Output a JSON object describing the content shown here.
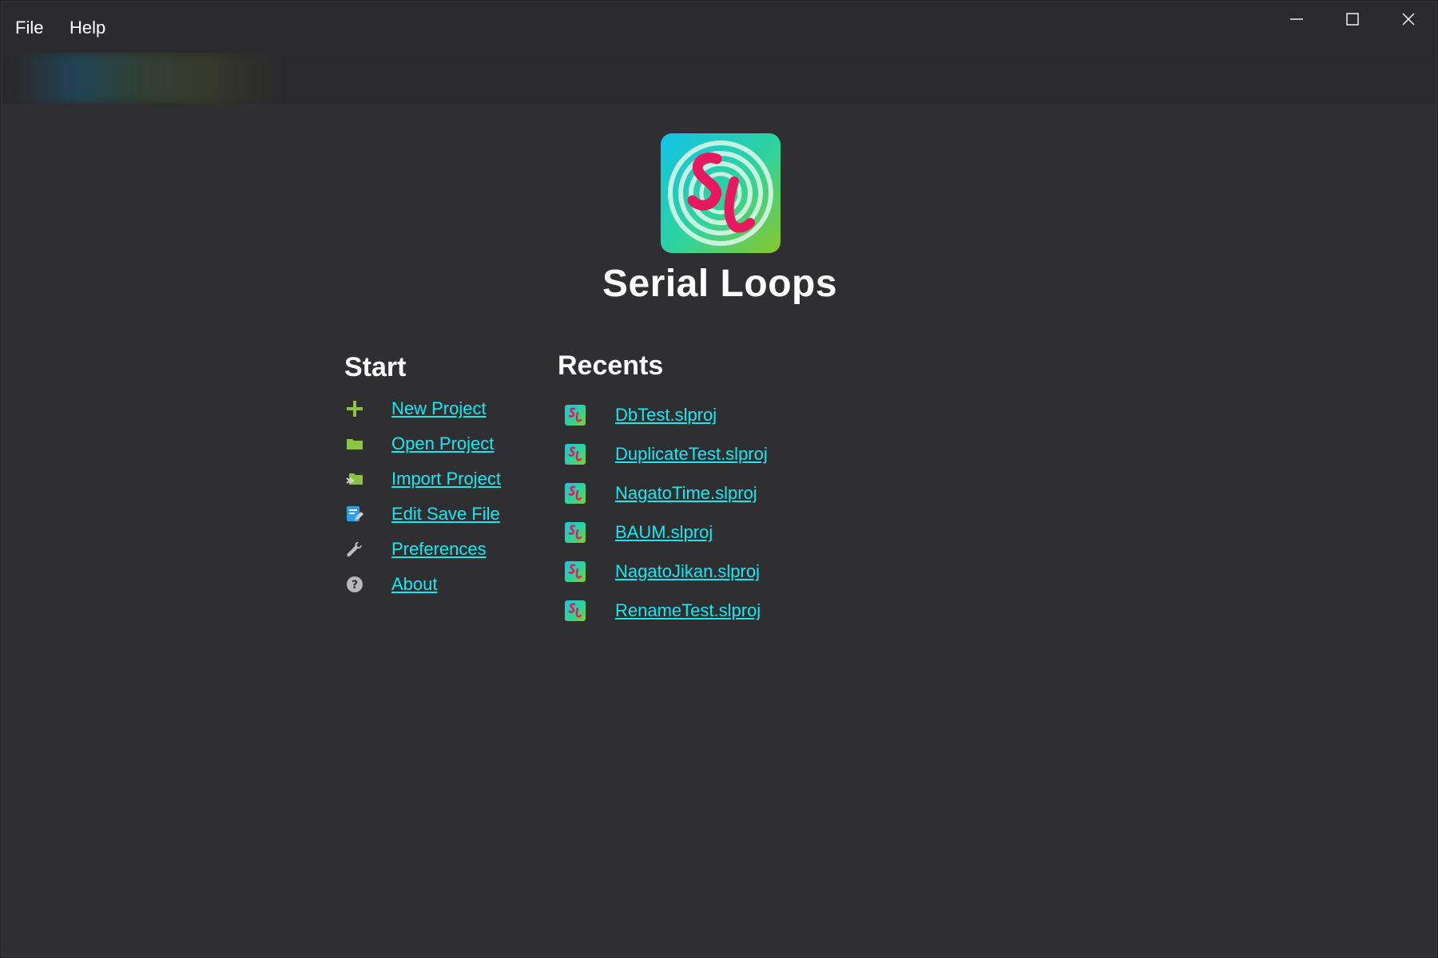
{
  "menu": {
    "file": "File",
    "help": "Help"
  },
  "app": {
    "title": "Serial Loops"
  },
  "start": {
    "heading": "Start",
    "items": [
      {
        "label": "New Project",
        "icon": "plus-icon"
      },
      {
        "label": "Open Project",
        "icon": "folder-icon"
      },
      {
        "label": "Import Project",
        "icon": "import-folder-icon"
      },
      {
        "label": "Edit Save File",
        "icon": "edit-save-icon"
      },
      {
        "label": "Preferences",
        "icon": "wrench-icon"
      },
      {
        "label": "About",
        "icon": "question-icon"
      }
    ]
  },
  "recents": {
    "heading": "Recents",
    "items": [
      {
        "label": "DbTest.slproj"
      },
      {
        "label": "DuplicateTest.slproj"
      },
      {
        "label": "NagatoTime.slproj"
      },
      {
        "label": "BAUM.slproj"
      },
      {
        "label": "NagatoJikan.slproj"
      },
      {
        "label": "RenameTest.slproj"
      }
    ]
  },
  "colors": {
    "background": "#2f2f31",
    "link": "#19e6ef",
    "accent_green": "#8bc53f",
    "logo_pink": "#e8185f"
  }
}
